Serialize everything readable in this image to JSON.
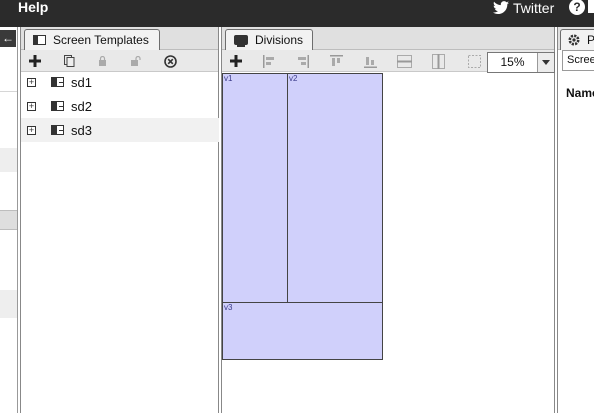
{
  "menubar": {
    "help": "Help",
    "twitter": "Twitter"
  },
  "templates": {
    "tab_label": "Screen Templates",
    "items": [
      {
        "label": "sd1",
        "selected": false
      },
      {
        "label": "sd2",
        "selected": false
      },
      {
        "label": "sd3",
        "selected": true
      }
    ]
  },
  "divisions": {
    "tab_label": "Divisions",
    "zoom": "15%",
    "boxes": [
      {
        "label": "v1"
      },
      {
        "label": "v2"
      },
      {
        "label": "v3"
      }
    ]
  },
  "props": {
    "tab_label": "P",
    "subtab_label": "Scree",
    "name_label": "Name"
  },
  "colors": {
    "division_fill": "#d0d0fb",
    "menubar": "#2b2b2b"
  }
}
